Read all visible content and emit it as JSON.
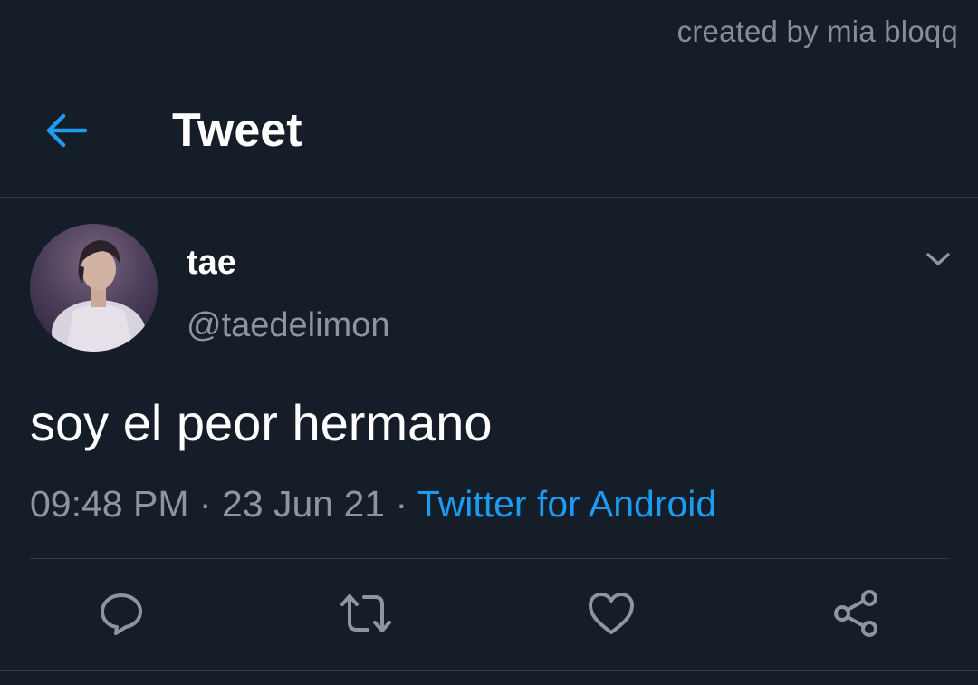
{
  "credit": "created by mia bloqq",
  "header": {
    "title": "Tweet",
    "back_icon": "arrow-left-icon"
  },
  "author": {
    "name": "tae",
    "handle": "@taedelimon"
  },
  "tweet": {
    "text": "soy el peor hermano",
    "time": "09:48 PM",
    "separator": "·",
    "date": "23 Jun 21",
    "source": "Twitter for Android"
  },
  "actions": [
    "reply-icon",
    "retweet-icon",
    "like-icon",
    "share-icon"
  ],
  "colors": {
    "background": "#151d28",
    "accent": "#1d9bf0",
    "secondary_text": "#8b96a2",
    "divider": "#303a46"
  }
}
